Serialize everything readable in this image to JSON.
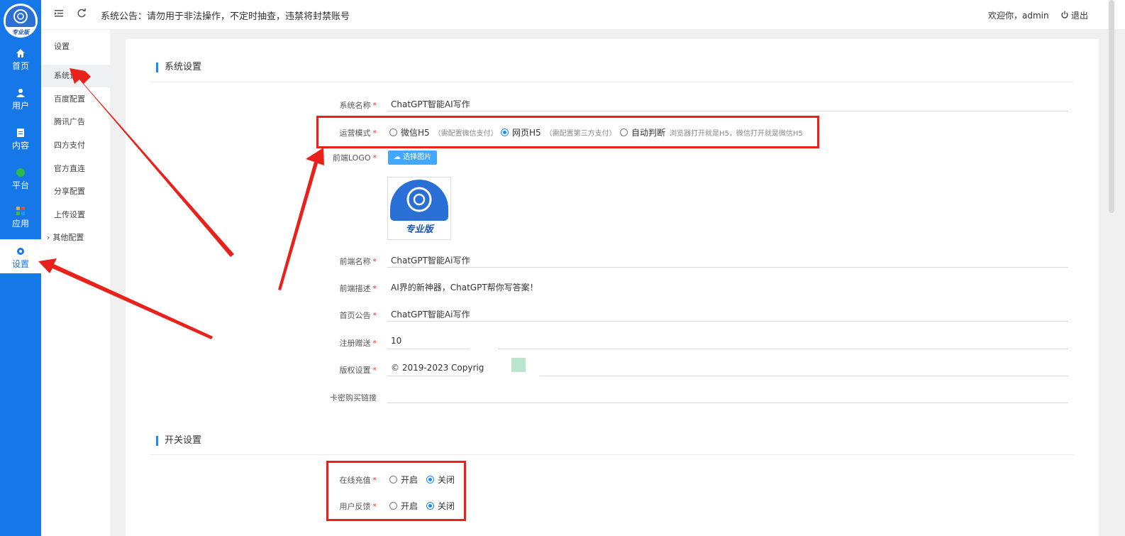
{
  "rail": {
    "logo_text": "专业版",
    "items": [
      {
        "label": "首页",
        "icon": "home-icon"
      },
      {
        "label": "用户",
        "icon": "user-icon"
      },
      {
        "label": "内容",
        "icon": "document-icon"
      },
      {
        "label": "平台",
        "icon": "platform-icon"
      },
      {
        "label": "应用",
        "icon": "apps-icon"
      },
      {
        "label": "设置",
        "icon": "gear-icon"
      }
    ]
  },
  "topbar": {
    "notice": "系统公告：请勿用于非法操作，不定时抽查，违禁将封禁账号",
    "welcome": "欢迎你，admin",
    "logout": "退出"
  },
  "submenu": {
    "header": "设置",
    "items": [
      "系统设置",
      "百度配置",
      "腾讯广告",
      "四方支付",
      "官方直连",
      "分享配置",
      "上传设置",
      "其他配置"
    ]
  },
  "form": {
    "section1_title": "系统设置",
    "system_name_label": "系统名称",
    "system_name_value": "ChatGPT智能AI写作",
    "run_mode_label": "运营模式",
    "run_mode_options": [
      {
        "label": "微信H5",
        "hint": "（需配置微信支付）",
        "selected": false
      },
      {
        "label": "网页H5",
        "hint": "（需配置第三方支付）",
        "selected": true
      },
      {
        "label": "自动判断",
        "hint": "浏览器打开就是H5，微信打开就是微信H5",
        "selected": false
      }
    ],
    "logo_label": "前端LOGO",
    "upload_label": "选择图片",
    "logo_preview_text": "专业版",
    "front_name_label": "前端名称",
    "front_name_value": "ChatGPT智能Ai写作",
    "front_desc_label": "前端描述",
    "front_desc_value": "AI界的新神器，ChatGPT帮你写答案！",
    "home_notice_label": "首页公告",
    "home_notice_value": "ChatGPT智能Ai写作",
    "register_gift_label": "注册赠送",
    "register_gift_value": "10",
    "copyright_label": "版权设置",
    "copyright_value": "© 2019-2023 Copyrig",
    "card_link_label": "卡密购买链接",
    "section2_title": "开关设置",
    "online_recharge_label": "在线充值",
    "user_feedback_label": "用户反馈",
    "on_label": "开启",
    "off_label": "关闭"
  },
  "colors": {
    "rail_blue": "#1577e8",
    "accent": "#1a8cf0",
    "annotation_red": "#e8211a"
  }
}
